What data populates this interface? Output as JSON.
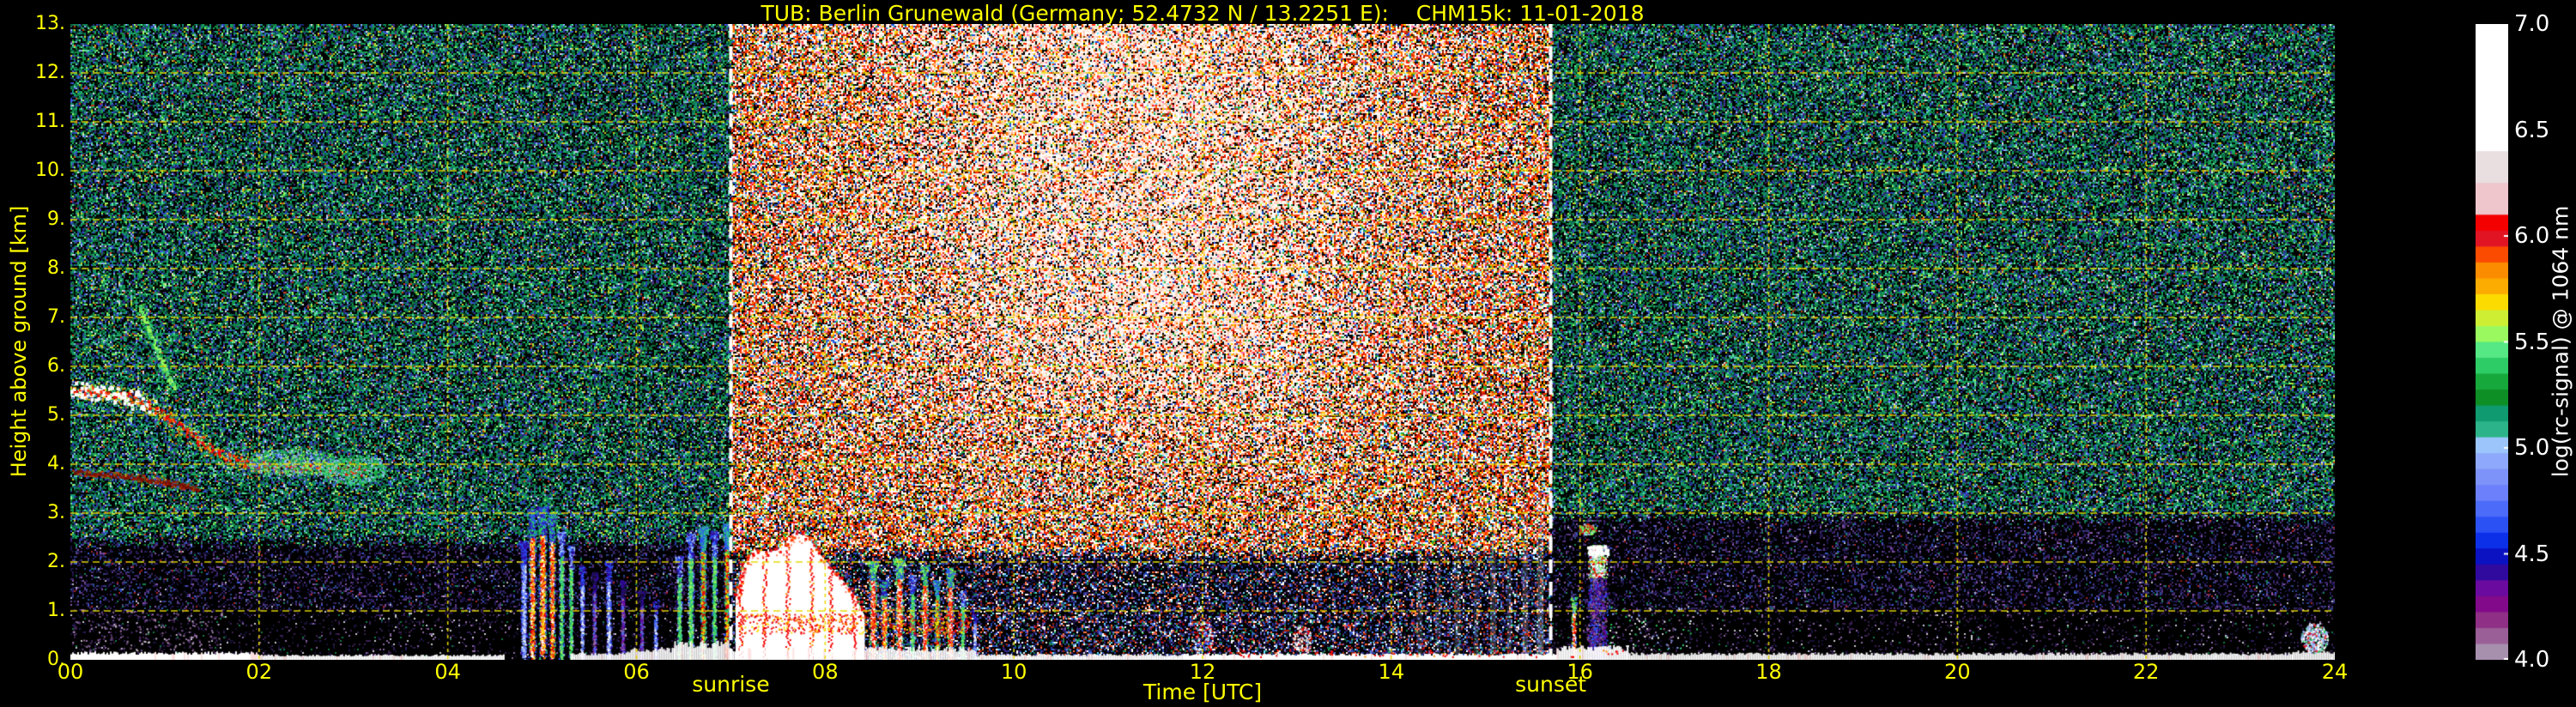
{
  "title": "TUB: Berlin Grunewald (Germany; 52.4732 N / 13.2251 E):    CHM15k: 11-01-2018",
  "colors": {
    "background": "#000000",
    "axis_text": "#ffff00",
    "grid": "#e8d900",
    "daynight_line": "#ffffff",
    "colorbar_text": "#ffffff"
  },
  "axes": {
    "x_label": "Time [UTC]",
    "x_ticks": [
      "00",
      "02",
      "04",
      "06",
      "08",
      "10",
      "12",
      "14",
      "16",
      "18",
      "20",
      "22",
      "24"
    ],
    "x_tick_hours": [
      0,
      2,
      4,
      6,
      8,
      10,
      12,
      14,
      16,
      18,
      20,
      22,
      24
    ],
    "y_label": "Height above ground [km]",
    "y_ticks": [
      "13.",
      "12.",
      "11.",
      "10.",
      "9.",
      "8.",
      "7.",
      "6.",
      "5.",
      "4.",
      "3.",
      "2.",
      "1.",
      "0."
    ],
    "y_tick_km": [
      13,
      12,
      11,
      10,
      9,
      8,
      7,
      6,
      5,
      4,
      3,
      2,
      1,
      0
    ],
    "grid_x_step_hours": 2,
    "grid_y_step_km": 1
  },
  "annotations": {
    "sunrise_label": "sunrise",
    "sunset_label": "sunset",
    "sunrise_hour": 7.0,
    "sunset_hour": 15.69
  },
  "colorbar": {
    "label": "log(rc-signal) @ 1064 nm",
    "ticks": [
      "7.0",
      "6.5",
      "6.0",
      "5.5",
      "5.0",
      "4.5",
      "4.0"
    ],
    "tick_values": [
      7.0,
      6.5,
      6.0,
      5.5,
      5.0,
      4.5,
      4.0
    ],
    "min": 4.0,
    "max": 7.0,
    "band_colors_top_to_bottom": [
      "#ffffff",
      "#ffffff",
      "#ffffff",
      "#ffffff",
      "#ffffff",
      "#ffffff",
      "#ffffff",
      "#ffffff",
      "#e9dfe0",
      "#e9dfe0",
      "#eec6cb",
      "#eec6cb",
      "#f40000",
      "#e11423",
      "#fb4b00",
      "#fb8c00",
      "#fcab00",
      "#fcdc00",
      "#ceee33",
      "#99f95e",
      "#55e884",
      "#2ecc66",
      "#17a83c",
      "#0d8f26",
      "#0f9a70",
      "#2db389",
      "#9cc6fb",
      "#8ea9fb",
      "#7d93fa",
      "#6b80fa",
      "#4b6bf8",
      "#2b51f5",
      "#0c30e8",
      "#0a12c1",
      "#30099e",
      "#6a0a9e",
      "#820a8a",
      "#8f2f86",
      "#9a5f96",
      "#a78fae"
    ]
  },
  "chart_data": {
    "type": "heatmap",
    "x_unit": "hours UTC",
    "y_unit": "km above ground",
    "x_range": [
      0,
      24
    ],
    "y_range": [
      0,
      13
    ],
    "value_label": "log(rc-signal) @ 1064 nm",
    "value_range": [
      4.0,
      7.0
    ],
    "day_region": {
      "start_hour": 7.0,
      "end_hour": 15.69,
      "low_top_km": 2.2
    },
    "night_boundary_km_pre_sunrise": 2.45,
    "night_boundary_km_post_sunset": 2.95,
    "palettes": {
      "night_high": [
        [
          "#000000",
          0.3
        ],
        [
          "#04200f",
          0.06
        ],
        [
          "#0b5e32",
          0.09
        ],
        [
          "#128c46",
          0.09
        ],
        [
          "#1aa85e",
          0.07
        ],
        [
          "#0e6e5a",
          0.06
        ],
        [
          "#17957d",
          0.05
        ],
        [
          "#5fe0a5",
          0.03
        ],
        [
          "#1b2a6e",
          0.06
        ],
        [
          "#2a3fae",
          0.05
        ],
        [
          "#3a57d6",
          0.03
        ],
        [
          "#8ea9fb",
          0.02
        ],
        [
          "#4a2a7a",
          0.025
        ],
        [
          "#c8c81e",
          0.02
        ],
        [
          "#c83c14",
          0.015
        ],
        [
          "#e0e0e0",
          0.01
        ],
        [
          "#99f95e",
          0.02
        ]
      ],
      "night_mid": [
        [
          "#000000",
          0.7
        ],
        [
          "#191242",
          0.08
        ],
        [
          "#2a1e5e",
          0.06
        ],
        [
          "#41286e",
          0.045
        ],
        [
          "#5a3a85",
          0.035
        ],
        [
          "#2a4a8a",
          0.03
        ],
        [
          "#158055",
          0.013
        ],
        [
          "#8a56a8",
          0.015
        ],
        [
          "#b8b8c8",
          0.006
        ],
        [
          "#aa2222",
          0.006
        ],
        [
          "#3a57d6",
          0.01
        ]
      ],
      "night_low": [
        [
          "#000000",
          0.875
        ],
        [
          "#3a2050",
          0.045
        ],
        [
          "#181035",
          0.04
        ],
        [
          "#8a66a0",
          0.015
        ],
        [
          "#c8c8d0",
          0.008
        ],
        [
          "#117a44",
          0.008
        ],
        [
          "#2a1e5e",
          0.009
        ]
      ],
      "day_high": [
        [
          "#000000",
          0.16
        ],
        [
          "#ffffff",
          0.16
        ],
        [
          "#ff2a00",
          0.12
        ],
        [
          "#c81800",
          0.07
        ],
        [
          "#ff7700",
          0.08
        ],
        [
          "#ffd400",
          0.06
        ],
        [
          "#7a1000",
          0.05
        ],
        [
          "#ffb090",
          0.05
        ],
        [
          "#22aa44",
          0.05
        ],
        [
          "#2255dd",
          0.05
        ],
        [
          "#66ddff",
          0.03
        ],
        [
          "#ff66aa",
          0.03
        ],
        [
          "#885500",
          0.03
        ],
        [
          "#ccffcc",
          0.03
        ],
        [
          "#123456",
          0.02
        ]
      ],
      "day_low": [
        [
          "#000000",
          0.5
        ],
        [
          "#191242",
          0.1
        ],
        [
          "#33227a",
          0.07
        ],
        [
          "#2244aa",
          0.06
        ],
        [
          "#aa2200",
          0.05
        ],
        [
          "#ffffff",
          0.05
        ],
        [
          "#ff7744",
          0.04
        ],
        [
          "#158055",
          0.04
        ],
        [
          "#5577dd",
          0.05
        ],
        [
          "#8a56a8",
          0.03
        ],
        [
          "#66ddff",
          0.02
        ]
      ]
    },
    "features": [
      {
        "type": "streak",
        "name": "descending-aerosol-layer",
        "path": [
          [
            0.02,
            5.55
          ],
          [
            0.3,
            5.5
          ],
          [
            0.6,
            5.4
          ],
          [
            0.9,
            5.15
          ],
          [
            1.15,
            4.8
          ],
          [
            1.45,
            4.35
          ],
          [
            1.75,
            4.1
          ],
          [
            2.1,
            3.95
          ],
          [
            2.5,
            3.95
          ],
          [
            2.9,
            3.9
          ],
          [
            3.15,
            3.85
          ]
        ],
        "halo": [
          "#35c48f",
          "#2ecc66",
          "#3a57d6",
          "#9cc6fb"
        ],
        "mid": [
          "#ffdc00",
          "#fb8c00",
          "#99f95e"
        ],
        "core": [
          "#f40000",
          "#ff3300"
        ],
        "white_core_until": 0.85,
        "halo_r": 20,
        "mid_r": 10,
        "core_r": 5
      },
      {
        "type": "streak",
        "name": "upper-green-streak",
        "path": [
          [
            0.72,
            7.25
          ],
          [
            0.82,
            6.8
          ],
          [
            0.92,
            6.3
          ],
          [
            1.02,
            5.85
          ],
          [
            1.12,
            5.5
          ]
        ],
        "halo": [
          "#2ecc66",
          "#17a83c"
        ],
        "mid": [
          "#2ecc66",
          "#35c48f"
        ],
        "core": [
          "#99f95e"
        ],
        "white_core_until": 0,
        "halo_r": 10,
        "mid_r": 5,
        "core_r": 2
      },
      {
        "type": "streak",
        "name": "thin-lower-streak",
        "path": [
          [
            0.05,
            3.85
          ],
          [
            0.4,
            3.8
          ],
          [
            0.75,
            3.72
          ],
          [
            1.1,
            3.6
          ],
          [
            1.35,
            3.5
          ]
        ],
        "halo": [
          "#30992e",
          "#3a57d6"
        ],
        "mid": [
          "#aa2200",
          "#cc4400"
        ],
        "core": [
          "#7a1000"
        ],
        "white_core_until": 0,
        "halo_r": 7,
        "mid_r": 4,
        "core_r": 2
      },
      {
        "type": "blob",
        "name": "cloud-fragment",
        "tc": 2.35,
        "kc": 4.05,
        "rt": 0.5,
        "rk": 0.28,
        "n": 700,
        "colors": [
          "#2ecc66",
          "#17a83c",
          "#9cc6fb",
          "#3a57d6",
          "#99f95e"
        ]
      },
      {
        "type": "blob",
        "name": "cloud-fragment",
        "tc": 3.0,
        "kc": 3.9,
        "rt": 0.35,
        "rk": 0.3,
        "n": 450,
        "colors": [
          "#2ecc66",
          "#35c48f",
          "#9cc6fb",
          "#17a83c"
        ]
      },
      {
        "type": "speckle_rect",
        "name": "surface-purple-layer",
        "t0": 0.0,
        "t1": 1.6,
        "k0": 0.2,
        "k1": 1.0,
        "density": 0.1,
        "colors": [
          "#9a6b9d",
          "#a083a8",
          "#6a4a8a",
          "#c9b6cf",
          "#4a2a6a"
        ]
      },
      {
        "type": "columns",
        "name": "early-morning-precip",
        "items": [
          [
            4.8,
            0.07,
            2.3,
            "blue"
          ],
          [
            4.89,
            0.08,
            2.95,
            "red"
          ],
          [
            5.0,
            0.09,
            3.0,
            "red"
          ],
          [
            5.1,
            0.07,
            2.85,
            "red"
          ],
          [
            5.2,
            0.06,
            2.5,
            "green"
          ],
          [
            5.3,
            0.05,
            2.2,
            "green"
          ],
          [
            5.42,
            0.05,
            1.8,
            "blue"
          ],
          [
            5.55,
            0.05,
            1.65,
            "purple"
          ],
          [
            5.7,
            0.06,
            1.9,
            "blue"
          ],
          [
            5.85,
            0.05,
            1.5,
            "purple"
          ],
          [
            6.05,
            0.05,
            1.3,
            "purple"
          ],
          [
            6.2,
            0.04,
            1.1,
            "blue"
          ],
          [
            6.45,
            0.06,
            2.0,
            "green"
          ],
          [
            6.57,
            0.07,
            2.45,
            "green"
          ],
          [
            6.7,
            0.07,
            2.6,
            "greenred"
          ],
          [
            6.82,
            0.06,
            2.5,
            "green"
          ],
          [
            6.95,
            0.06,
            2.65,
            "greenred"
          ]
        ]
      },
      {
        "type": "cloud",
        "name": "sunrise-cloud-mass",
        "profile": [
          [
            7.05,
            1.25
          ],
          [
            7.12,
            1.9
          ],
          [
            7.25,
            2.25
          ],
          [
            7.4,
            2.2
          ],
          [
            7.55,
            2.3
          ],
          [
            7.68,
            2.62
          ],
          [
            7.82,
            2.5
          ],
          [
            7.95,
            2.15
          ],
          [
            8.08,
            1.85
          ],
          [
            8.2,
            1.6
          ],
          [
            8.32,
            1.3
          ],
          [
            8.42,
            0.9
          ]
        ],
        "border": [
          "#f40000",
          "#ff4400",
          "#e11423"
        ],
        "cap": [
          "#2ecc66",
          "#99f95e"
        ],
        "streaks": [
          [
            7.1,
            2.0
          ],
          [
            7.35,
            2.1
          ],
          [
            7.6,
            2.4
          ],
          [
            7.85,
            2.3
          ],
          [
            8.05,
            1.8
          ],
          [
            8.3,
            1.4
          ]
        ]
      },
      {
        "type": "columns",
        "name": "morning-clouds",
        "items": [
          [
            8.5,
            0.08,
            1.9,
            "redwhite"
          ],
          [
            8.62,
            0.07,
            1.5,
            "red"
          ],
          [
            8.78,
            0.09,
            1.95,
            "redwhite"
          ],
          [
            8.92,
            0.06,
            1.6,
            "green"
          ],
          [
            9.05,
            0.07,
            1.8,
            "redwhite"
          ],
          [
            9.18,
            0.06,
            1.5,
            "greenred"
          ],
          [
            9.32,
            0.07,
            1.75,
            "redwhite"
          ],
          [
            9.45,
            0.05,
            1.3,
            "green"
          ],
          [
            9.58,
            0.04,
            0.9,
            "blue"
          ]
        ]
      },
      {
        "type": "hband",
        "name": "red-layer",
        "t0": 7.05,
        "t1": 9.55,
        "km": 0.75,
        "thick": 0.2,
        "density": 0.5,
        "colors": [
          "#f40000",
          "#e11423",
          "#ff6600",
          "#ffdc00"
        ]
      },
      {
        "type": "faint_stripes",
        "name": "afternoon-faint-streaks",
        "color": "#cfe0ff",
        "items": [
          [
            14.3,
            0.06,
            3.2,
            0.13
          ],
          [
            14.5,
            0.05,
            2.8,
            0.11
          ],
          [
            14.7,
            0.06,
            3.6,
            0.14
          ],
          [
            14.9,
            0.05,
            3.0,
            0.12
          ],
          [
            15.08,
            0.06,
            3.9,
            0.16
          ],
          [
            15.25,
            0.05,
            3.4,
            0.14
          ],
          [
            15.42,
            0.06,
            4.1,
            0.18
          ],
          [
            15.58,
            0.07,
            4.4,
            0.22
          ]
        ]
      },
      {
        "type": "specks",
        "name": "daytime-ground-specks",
        "t0": 9.6,
        "t1": 15.6,
        "k0": 0.15,
        "k1": 0.95,
        "n": 260,
        "size": 2,
        "colors": [
          "#ffffff",
          "#9cc6fb",
          "#f40000",
          "#2ecc66",
          "#4a6af8"
        ]
      },
      {
        "type": "blob",
        "name": "midday-ground-cluster",
        "tc": 12.0,
        "kc": 0.45,
        "rt": 0.12,
        "rk": 0.35,
        "n": 140,
        "colors": [
          "#ffffff",
          "#9cc6fb",
          "#f40000",
          "#2b51f5"
        ]
      },
      {
        "type": "blob",
        "name": "midday-ground-cluster",
        "tc": 13.05,
        "kc": 0.4,
        "rt": 0.1,
        "rk": 0.3,
        "n": 100,
        "colors": [
          "#ffffff",
          "#dddddd",
          "#f40000"
        ]
      },
      {
        "type": "columns",
        "name": "pre-plume-column",
        "items": [
          [
            15.93,
            0.05,
            1.15,
            "redwhite"
          ]
        ]
      },
      {
        "type": "plume",
        "name": "evening-plume",
        "tc": 16.18,
        "w": 0.22,
        "top": 2.35
      },
      {
        "type": "blob",
        "name": "evening-cloudlet",
        "tc": 16.08,
        "kc": 2.68,
        "rt": 0.09,
        "rk": 0.12,
        "n": 120,
        "colors": [
          "#2ecc66",
          "#99f95e",
          "#f40000",
          "#9cc6fb"
        ]
      },
      {
        "type": "ground_band",
        "name": "surface-echo",
        "segments": [
          [
            0.0,
            2.0,
            0.14
          ],
          [
            2.0,
            4.6,
            0.09
          ],
          [
            5.3,
            5.9,
            0.12
          ],
          [
            5.9,
            6.4,
            0.2
          ],
          [
            6.4,
            7.0,
            0.32
          ],
          [
            7.0,
            9.6,
            0.22
          ],
          [
            9.6,
            11.8,
            0.1
          ],
          [
            11.8,
            15.75,
            0.11
          ],
          [
            15.75,
            16.5,
            0.24
          ],
          [
            16.5,
            23.55,
            0.12
          ],
          [
            23.55,
            24.0,
            0.16
          ]
        ],
        "red_speck_ranges": [
          [
            12.2,
            15.6
          ],
          [
            15.8,
            16.45
          ]
        ]
      },
      {
        "type": "blob",
        "name": "late-night-echo",
        "tc": 23.78,
        "kc": 0.45,
        "rt": 0.14,
        "rk": 0.3,
        "n": 420,
        "colors": [
          "#ffffff",
          "#ffffff",
          "#9cc6fb",
          "#2ecc66",
          "#e11423",
          "#8ea9fb"
        ]
      },
      {
        "type": "specks",
        "name": "evening-low-specks",
        "t0": 16.3,
        "t1": 17.3,
        "k0": 0.2,
        "k1": 1.1,
        "n": 80,
        "size": 2,
        "colors": [
          "#9a6b9d",
          "#8ea9fb",
          "#ffffff",
          "#2ecc66"
        ]
      }
    ]
  }
}
